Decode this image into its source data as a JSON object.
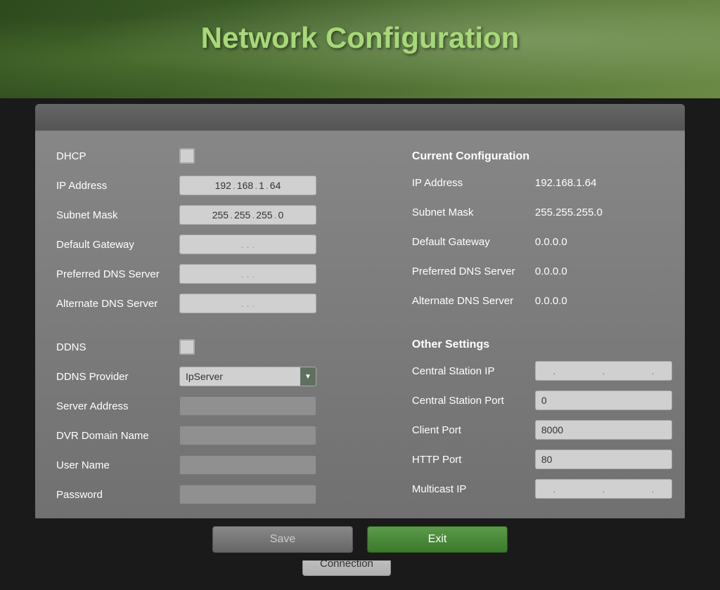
{
  "page": {
    "title": "Network Configuration"
  },
  "left": {
    "dhcp_label": "DHCP",
    "ip_address_label": "IP Address",
    "ip_address_value": "192 . 168 . 1 . 64",
    "subnet_mask_label": "Subnet Mask",
    "subnet_mask_value": "255 . 255 . 255 . 0",
    "default_gateway_label": "Default Gateway",
    "preferred_dns_label": "Preferred DNS Server",
    "alternate_dns_label": "Alternate DNS Server",
    "ddns_label": "DDNS",
    "ddns_provider_label": "DDNS Provider",
    "ddns_provider_value": "IpServer",
    "server_address_label": "Server Address",
    "dvr_domain_label": "DVR Domain Name",
    "user_name_label": "User Name",
    "password_label": "Password",
    "test_connection_label": "Test Connection"
  },
  "right": {
    "current_config_title": "Current Configuration",
    "ip_address_label": "IP Address",
    "ip_address_value": "192.168.1.64",
    "subnet_mask_label": "Subnet Mask",
    "subnet_mask_value": "255.255.255.0",
    "default_gateway_label": "Default Gateway",
    "default_gateway_value": "0.0.0.0",
    "preferred_dns_label": "Preferred DNS Server",
    "preferred_dns_value": "0.0.0.0",
    "alternate_dns_label": "Alternate DNS Server",
    "alternate_dns_value": "0.0.0.0",
    "other_settings_title": "Other Settings",
    "central_station_ip_label": "Central Station IP",
    "central_station_port_label": "Central Station Port",
    "central_station_port_value": "0",
    "client_port_label": "Client Port",
    "client_port_value": "8000",
    "http_port_label": "HTTP Port",
    "http_port_value": "80",
    "multicast_ip_label": "Multicast IP"
  },
  "buttons": {
    "save_label": "Save",
    "exit_label": "Exit"
  }
}
